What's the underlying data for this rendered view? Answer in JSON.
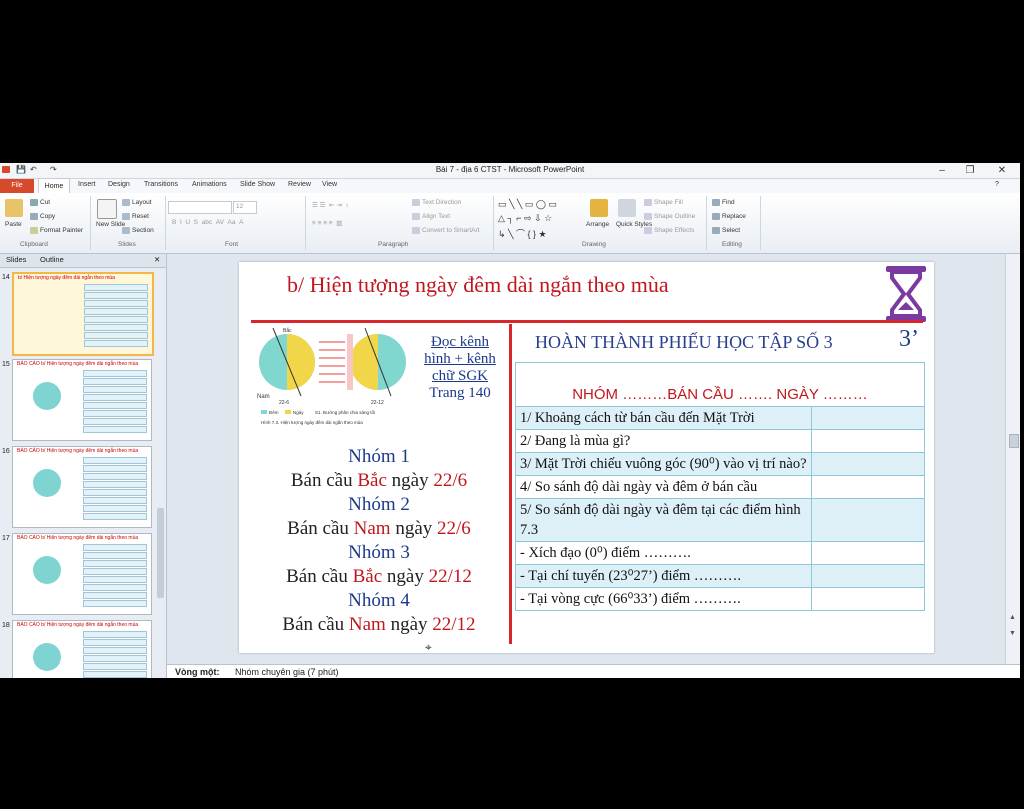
{
  "window": {
    "title": "Bài 7 - địa 6 CTST  -  Microsoft PowerPoint",
    "controls": {
      "minimize": "–",
      "restore": "❐",
      "close": "✕"
    }
  },
  "ribbon": {
    "file_tab": "File",
    "tabs": [
      "Home",
      "Insert",
      "Design",
      "Transitions",
      "Animations",
      "Slide Show",
      "Review",
      "View"
    ],
    "clipboard": {
      "paste": "Paste",
      "cut": "Cut",
      "copy": "Copy",
      "format_painter": "Format Painter",
      "label": "Clipboard"
    },
    "slides": {
      "new_slide": "New Slide",
      "layout": "Layout",
      "reset": "Reset",
      "section": "Section",
      "label": "Slides"
    },
    "font": {
      "size": "12",
      "label": "Font"
    },
    "paragraph": {
      "text_direction": "Text Direction",
      "align_text": "Align Text",
      "smartart": "Convert to SmartArt",
      "label": "Paragraph"
    },
    "drawing": {
      "arrange": "Arrange",
      "quick_styles": "Quick Styles",
      "shape_fill": "Shape Fill",
      "shape_outline": "Shape Outline",
      "shape_effects": "Shape Effects",
      "label": "Drawing"
    },
    "editing": {
      "find": "Find",
      "replace": "Replace",
      "select": "Select",
      "label": "Editing"
    }
  },
  "panel": {
    "tabs": [
      "Slides",
      "Outline"
    ],
    "thumbs": [
      {
        "num": "14",
        "title": "b/ Hiện tượng ngày đêm dài ngắn theo mùa"
      },
      {
        "num": "15",
        "title": "BÁO CÁO   b/ Hiện tượng ngày đêm dài ngắn theo mùa"
      },
      {
        "num": "16",
        "title": "BÁO CÁO   b/ Hiện tượng ngày đêm dài ngắn theo mùa"
      },
      {
        "num": "17",
        "title": "BÁO CÁO   b/ Hiện tượng ngày đêm dài ngắn theo mùa"
      },
      {
        "num": "18",
        "title": "BÁO CÁO   b/ Hiện tượng ngày đêm dài ngắn theo mùa"
      }
    ]
  },
  "notes": {
    "label": "Vòng một:",
    "text": "Nhóm chuyên gia (7 phút)"
  },
  "slide": {
    "title": "b/ Hiện tượng ngày đêm dài ngắn theo mùa",
    "read": [
      "Đọc kênh",
      "hình + kênh",
      "chữ SGK",
      "Trang 140"
    ],
    "groups": [
      {
        "name": "Nhóm 1",
        "pre": "Bán cầu ",
        "hemi": "Bắc",
        "mid": " ngày ",
        "date": "22/6"
      },
      {
        "name": "Nhóm 2",
        "pre": "Bán cầu ",
        "hemi": "Nam",
        "mid": " ngày ",
        "date": "22/6"
      },
      {
        "name": "Nhóm 3",
        "pre": "Bán cầu ",
        "hemi": "Bắc",
        "mid": " ngày ",
        "date": "22/12"
      },
      {
        "name": "Nhóm 4",
        "pre": "Bán cầu ",
        "hemi": "Nam",
        "mid": " ngày ",
        "date": "22/12"
      }
    ],
    "worksheet_title": "HOÀN THÀNH PHIẾU HỌC TẬP SỐ 3",
    "timer": "3’",
    "table_header": "NHÓM ………BÁN CẦU ……. NGÀY ………",
    "rows": [
      "1/ Khoảng cách từ bán cầu đến Mặt Trời",
      "2/ Đang là mùa gì?",
      "3/ Mặt Trời chiếu vuông góc (90⁰) vào vị trí nào?",
      "4/ So sánh độ dài ngày và đêm ở bán cầu",
      "5/ So sánh độ dài ngày và đêm tại các điểm hình 7.3",
      "-   Xích đạo (0⁰) điểm ……….",
      "-   Tại chí tuyến (23⁰27’) điểm ……….",
      "-   Tại vòng cực (66⁰33’) điểm ………."
    ],
    "diagram": {
      "left_label": "Nam",
      "left_date": "22-6",
      "right_date": "22-12",
      "top_label": "Bắc",
      "legend1": "Đêm",
      "legend2": "Ngày",
      "legend3": "S1. Đường phân chia sáng tối",
      "caption": "Hình 7.3. Hiện tượng ngày đêm dài ngắn theo mùa"
    }
  }
}
